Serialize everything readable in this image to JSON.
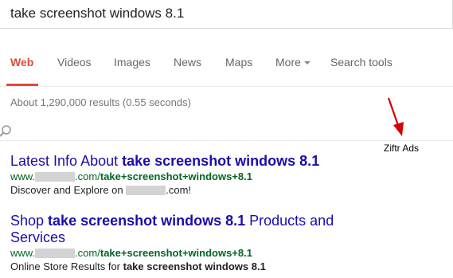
{
  "search": {
    "query": "take screenshot windows 8.1"
  },
  "tabs": [
    {
      "label": "Web"
    },
    {
      "label": "Videos"
    },
    {
      "label": "Images"
    },
    {
      "label": "News"
    },
    {
      "label": "Maps"
    },
    {
      "label": "More"
    },
    {
      "label": "Search tools"
    }
  ],
  "stats": {
    "text": "About 1,290,000 results (0.55 seconds)"
  },
  "annotation": {
    "label": "Ziftr Ads",
    "arrow_color": "#d50000"
  },
  "results": [
    {
      "title_prefix": "Latest Info About ",
      "title_bold": "take screenshot windows 8.1",
      "url_prefix": "www.",
      "url_domain_suffix": ".com/",
      "url_path_bold": "take+screenshot+windows+8.1",
      "snippet_prefix": "Discover and Explore on ",
      "snippet_suffix": ".com!"
    },
    {
      "title_prefix": "Shop ",
      "title_bold": "take screenshot windows 8.1",
      "title_suffix": " Products and Services",
      "url_prefix": "www.",
      "url_domain_suffix": ".com/",
      "url_path_bold": "take+screenshot+windows+8.1",
      "snippet_prefix": "Online Store Results for ",
      "snippet_bold": "take screenshot windows 8.1"
    }
  ],
  "colors": {
    "accent": "#dd4b39",
    "link": "#1a0dab",
    "url": "#006621",
    "arrow": "#d50000"
  }
}
